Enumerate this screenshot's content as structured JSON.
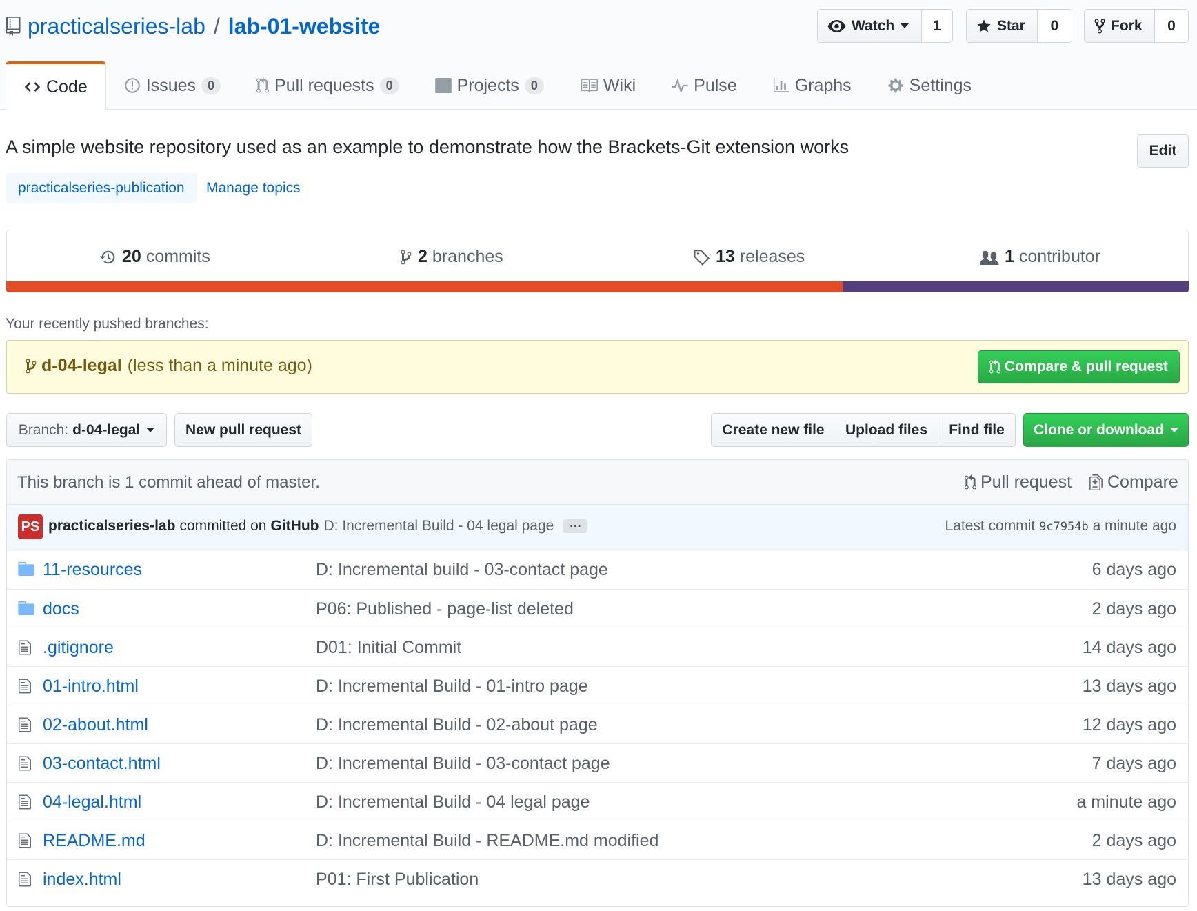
{
  "repo": {
    "owner": "practicalseries-lab",
    "separator": "/",
    "name": "lab-01-website"
  },
  "social": {
    "watch": {
      "label": "Watch",
      "count": "1"
    },
    "star": {
      "label": "Star",
      "count": "0"
    },
    "fork": {
      "label": "Fork",
      "count": "0"
    }
  },
  "tabs": [
    {
      "label": "Code",
      "icon": "code-icon"
    },
    {
      "label": "Issues",
      "count": "0",
      "icon": "issue-icon"
    },
    {
      "label": "Pull requests",
      "count": "0",
      "icon": "git-pull-request-icon"
    },
    {
      "label": "Projects",
      "count": "0",
      "icon": "project-icon"
    },
    {
      "label": "Wiki",
      "icon": "book-icon"
    },
    {
      "label": "Pulse",
      "icon": "pulse-icon"
    },
    {
      "label": "Graphs",
      "icon": "graph-icon"
    },
    {
      "label": "Settings",
      "icon": "gear-icon"
    }
  ],
  "description": "A simple website repository used as an example to demonstrate how the Brackets-Git extension works",
  "edit_label": "Edit",
  "topic": "practicalseries-publication",
  "manage_topics": "Manage topics",
  "stats": {
    "commits": {
      "num": "20",
      "label": "commits"
    },
    "branches": {
      "num": "2",
      "label": "branches"
    },
    "releases": {
      "num": "13",
      "label": "releases"
    },
    "contributors": {
      "num": "1",
      "label": "contributor"
    }
  },
  "languages": [
    {
      "color": "#e34c26",
      "share": 0.707
    },
    {
      "color": "#563d7c",
      "share": 0.293
    }
  ],
  "recent": {
    "label": "Your recently pushed branches:",
    "branch": "d-04-legal",
    "time": "(less than a minute ago)",
    "button": "Compare & pull request"
  },
  "toolbar": {
    "branch_prefix": "Branch:",
    "branch_name": "d-04-legal",
    "new_pr": "New pull request",
    "create_file": "Create new file",
    "upload_files": "Upload files",
    "find_file": "Find file",
    "clone": "Clone or download"
  },
  "ahead": {
    "text": "This branch is 1 commit ahead of master.",
    "pull_request": "Pull request",
    "compare": "Compare"
  },
  "latest_commit": {
    "avatar": "PS",
    "author": "practicalseries-lab",
    "committed_on": "committed on",
    "platform": "GitHub",
    "message": "D: Incremental Build - 04 legal page",
    "dots": "…",
    "latest_label": "Latest commit",
    "sha": "9c7954b",
    "time": "a minute ago"
  },
  "files": [
    {
      "type": "folder",
      "name": "11-resources",
      "message": "D: Incremental build - 03-contact page",
      "age": "6 days ago"
    },
    {
      "type": "folder",
      "name": "docs",
      "message": "P06: Published - page-list deleted",
      "age": "2 days ago"
    },
    {
      "type": "file",
      "name": ".gitignore",
      "message": "D01: Initial Commit",
      "age": "14 days ago"
    },
    {
      "type": "file",
      "name": "01-intro.html",
      "message": "D: Incremental Build - 01-intro page",
      "age": "13 days ago"
    },
    {
      "type": "file",
      "name": "02-about.html",
      "message": "D: Incremental Build - 02-about page",
      "age": "12 days ago"
    },
    {
      "type": "file",
      "name": "03-contact.html",
      "message": "D: Incremental Build - 03-contact page",
      "age": "7 days ago"
    },
    {
      "type": "file",
      "name": "04-legal.html",
      "message": "D: Incremental Build - 04 legal page",
      "age": "a minute ago"
    },
    {
      "type": "file",
      "name": "README.md",
      "message": "D: Incremental Build - README.md modified",
      "age": "2 days ago"
    },
    {
      "type": "file",
      "name": "index.html",
      "message": "P01: First Publication",
      "age": "13 days ago"
    }
  ]
}
